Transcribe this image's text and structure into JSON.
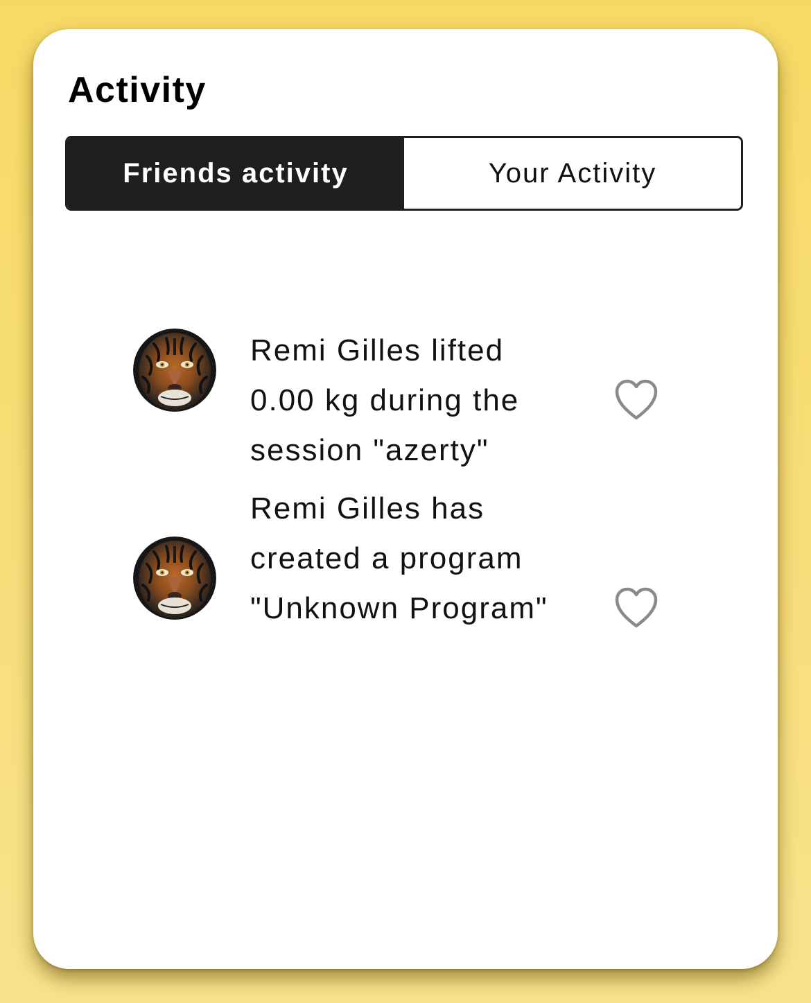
{
  "header": {
    "title": "Activity"
  },
  "tabs": [
    {
      "label": "Friends activity",
      "active": true
    },
    {
      "label": "Your Activity",
      "active": false
    }
  ],
  "activities": [
    {
      "text": "Remi Gilles lifted 0.00 kg during the session \"azerty\"",
      "avatar_icon": "tiger-avatar",
      "like_icon": "heart-outline-icon",
      "liked": false
    },
    {
      "text": "Remi Gilles has created a program \"Unknown Program\"",
      "avatar_icon": "tiger-avatar",
      "like_icon": "heart-outline-icon",
      "liked": false
    }
  ],
  "colors": {
    "background": "#f6d965",
    "card": "#ffffff",
    "tab_active": "#1e1e1e",
    "heart": "#8a8a8a"
  }
}
